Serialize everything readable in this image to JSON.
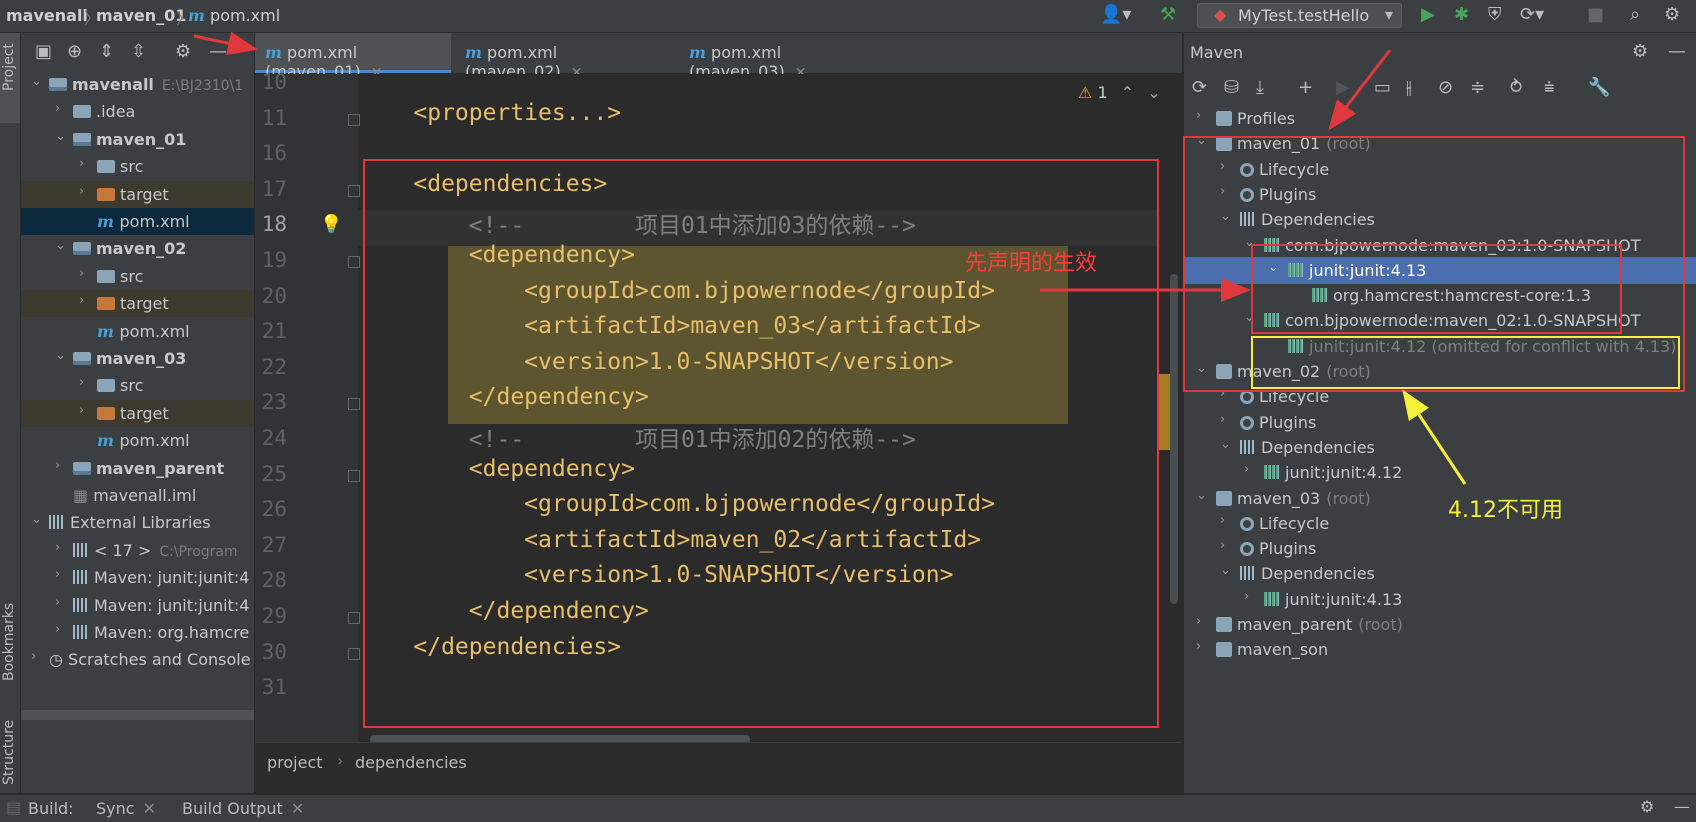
{
  "navbar": {
    "crumbs": [
      "mavenall",
      "maven_01",
      "pom.xml"
    ],
    "run_config": "MyTest.testHello"
  },
  "left_strip": {
    "project": "Project",
    "bookmarks": "Bookmarks",
    "structure": "Structure"
  },
  "project_tree": [
    {
      "label": "mavenall",
      "extra": "E:\\BJ2310\\1",
      "bold": true,
      "level": 0,
      "expanded": true,
      "icon": "module"
    },
    {
      "label": ".idea",
      "level": 1,
      "expanded": false,
      "icon": "folder"
    },
    {
      "label": "maven_01",
      "bold": true,
      "level": 1,
      "expanded": true,
      "icon": "module"
    },
    {
      "label": "src",
      "level": 2,
      "expanded": false,
      "icon": "folder"
    },
    {
      "label": "target",
      "level": 2,
      "expanded": false,
      "icon": "folder-orange"
    },
    {
      "label": "pom.xml",
      "level": 2,
      "icon": "maven-file",
      "selected": true
    },
    {
      "label": "maven_02",
      "bold": true,
      "level": 1,
      "expanded": true,
      "icon": "module"
    },
    {
      "label": "src",
      "level": 2,
      "expanded": false,
      "icon": "folder"
    },
    {
      "label": "target",
      "level": 2,
      "expanded": false,
      "icon": "folder-orange"
    },
    {
      "label": "pom.xml",
      "level": 2,
      "icon": "maven-file"
    },
    {
      "label": "maven_03",
      "bold": true,
      "level": 1,
      "expanded": true,
      "icon": "module"
    },
    {
      "label": "src",
      "level": 2,
      "expanded": false,
      "icon": "folder"
    },
    {
      "label": "target",
      "level": 2,
      "expanded": false,
      "icon": "folder-orange"
    },
    {
      "label": "pom.xml",
      "level": 2,
      "icon": "maven-file"
    },
    {
      "label": "maven_parent",
      "bold": true,
      "level": 1,
      "expanded": false,
      "icon": "module"
    },
    {
      "label": "mavenall.iml",
      "level": 1,
      "icon": "iml-file"
    },
    {
      "label": "External Libraries",
      "level": 0,
      "expanded": true,
      "icon": "library"
    },
    {
      "label": "< 17 >",
      "extra": "C:\\Program",
      "level": 1,
      "expanded": false,
      "icon": "jdk"
    },
    {
      "label": "Maven: junit:junit:4",
      "level": 1,
      "expanded": false,
      "icon": "library"
    },
    {
      "label": "Maven: junit:junit:4",
      "level": 1,
      "expanded": false,
      "icon": "library"
    },
    {
      "label": "Maven: org.hamcre",
      "level": 1,
      "expanded": false,
      "icon": "library"
    },
    {
      "label": "Scratches and Console",
      "level": 0,
      "expanded": false,
      "icon": "scratch"
    }
  ],
  "editor": {
    "tabs": [
      "pom.xml (maven_01)",
      "pom.xml (maven_02)",
      "pom.xml (maven_03)"
    ],
    "warning_count": "1",
    "lines": [
      {
        "n": "10",
        "code": ""
      },
      {
        "n": "11",
        "code": "    <properties...>"
      },
      {
        "n": "16",
        "code": ""
      },
      {
        "n": "17",
        "code": "    <dependencies>"
      },
      {
        "n": "18",
        "code": "        <!--        项目01中添加03的依赖-->"
      },
      {
        "n": "19",
        "code": "        <dependency>"
      },
      {
        "n": "20",
        "code": "            <groupId>com.bjpowernode</groupId>"
      },
      {
        "n": "21",
        "code": "            <artifactId>maven_03</artifactId>"
      },
      {
        "n": "22",
        "code": "            <version>1.0-SNAPSHOT</version>"
      },
      {
        "n": "23",
        "code": "        </dependency>"
      },
      {
        "n": "24",
        "code": "        <!--        项目01中添加02的依赖-->"
      },
      {
        "n": "25",
        "code": "        <dependency>"
      },
      {
        "n": "26",
        "code": "            <groupId>com.bjpowernode</groupId>"
      },
      {
        "n": "27",
        "code": "            <artifactId>maven_02</artifactId>"
      },
      {
        "n": "28",
        "code": "            <version>1.0-SNAPSHOT</version>"
      },
      {
        "n": "29",
        "code": "        </dependency>"
      },
      {
        "n": "30",
        "code": "    </dependencies>"
      },
      {
        "n": "31",
        "code": ""
      }
    ],
    "breadcrumb": [
      "project",
      "dependencies"
    ]
  },
  "maven": {
    "title": "Maven",
    "tree": [
      {
        "label": "Profiles",
        "level": 0,
        "expanded": false,
        "icon": "profiles"
      },
      {
        "label": "maven_01",
        "suffix": "(root)",
        "level": 0,
        "expanded": true,
        "icon": "module"
      },
      {
        "label": "Lifecycle",
        "level": 1,
        "expanded": false,
        "icon": "gear"
      },
      {
        "label": "Plugins",
        "level": 1,
        "expanded": false,
        "icon": "gear"
      },
      {
        "label": "Dependencies",
        "level": 1,
        "expanded": true,
        "icon": "deps"
      },
      {
        "label": "com.bjpowernode:maven_03:1.0-SNAPSHOT",
        "level": 2,
        "expanded": true,
        "icon": "lib"
      },
      {
        "label": "junit:junit:4.13",
        "level": 3,
        "expanded": true,
        "icon": "lib",
        "selected": true
      },
      {
        "label": "org.hamcrest:hamcrest-core:1.3",
        "level": 4,
        "icon": "lib"
      },
      {
        "label": "com.bjpowernode:maven_02:1.0-SNAPSHOT",
        "level": 2,
        "expanded": true,
        "icon": "lib"
      },
      {
        "label": "junit:junit:4.12 (omitted for conflict with 4.13)",
        "level": 3,
        "icon": "lib",
        "dim": true
      },
      {
        "label": "maven_02",
        "suffix": "(root)",
        "level": 0,
        "expanded": true,
        "icon": "module"
      },
      {
        "label": "Lifecycle",
        "level": 1,
        "expanded": false,
        "icon": "gear"
      },
      {
        "label": "Plugins",
        "level": 1,
        "expanded": false,
        "icon": "gear"
      },
      {
        "label": "Dependencies",
        "level": 1,
        "expanded": true,
        "icon": "deps"
      },
      {
        "label": "junit:junit:4.12",
        "level": 2,
        "expanded": false,
        "icon": "lib"
      },
      {
        "label": "maven_03",
        "suffix": "(root)",
        "level": 0,
        "expanded": true,
        "icon": "module"
      },
      {
        "label": "Lifecycle",
        "level": 1,
        "expanded": false,
        "icon": "gear"
      },
      {
        "label": "Plugins",
        "level": 1,
        "expanded": false,
        "icon": "gear"
      },
      {
        "label": "Dependencies",
        "level": 1,
        "expanded": true,
        "icon": "deps"
      },
      {
        "label": "junit:junit:4.13",
        "level": 2,
        "expanded": false,
        "icon": "lib"
      },
      {
        "label": "maven_parent",
        "suffix": "(root)",
        "level": 0,
        "expanded": false,
        "icon": "module"
      },
      {
        "label": "maven_son",
        "level": 0,
        "expanded": false,
        "icon": "module"
      }
    ]
  },
  "bottom": {
    "build_label": "Build:",
    "tabs": [
      "Sync",
      "Build Output"
    ]
  },
  "annotations": {
    "first_declared": "先声明的生效",
    "not_usable": "4.12不可用"
  },
  "colors": {
    "red": "#e0383c",
    "yellow": "#f5f03a",
    "selection": "#4b6eaf",
    "highlight": "#5c5530"
  }
}
